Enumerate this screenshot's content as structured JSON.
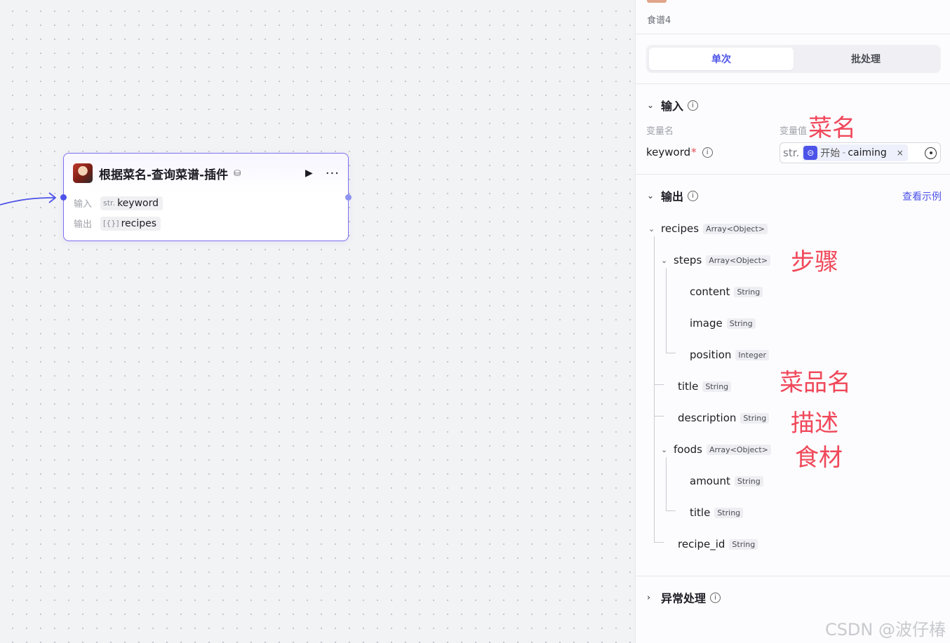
{
  "node": {
    "title": "根据菜名-查询菜谱-插件",
    "title_icon": "⛁",
    "run_icon": "▶",
    "more_icon": "···",
    "input_label": "输入",
    "input_type": "str.",
    "input_param": "keyword",
    "output_label": "输出",
    "output_type": "[{}]",
    "output_param": "recipes"
  },
  "panel": {
    "subtitle": "食谱4",
    "tabs": [
      "单次",
      "批处理"
    ],
    "input_section": "输入",
    "col_name": "变量名",
    "col_value": "变量值",
    "param_name": "keyword",
    "required_mark": "*",
    "value_type": "str.",
    "value_icon": "⊝",
    "value_source": "开始",
    "value_sep": "-",
    "value_var": "caiming",
    "value_clear": "×",
    "output_section": "输出",
    "view_example": "查看示例",
    "exception_section": "异常处理",
    "info_icon": "i"
  },
  "tree": [
    {
      "name": "recipes",
      "type": "Array<Object>"
    },
    {
      "name": "steps",
      "type": "Array<Object>"
    },
    {
      "name": "content",
      "type": "String"
    },
    {
      "name": "image",
      "type": "String"
    },
    {
      "name": "position",
      "type": "Integer"
    },
    {
      "name": "title",
      "type": "String"
    },
    {
      "name": "description",
      "type": "String"
    },
    {
      "name": "foods",
      "type": "Array<Object>"
    },
    {
      "name": "amount",
      "type": "String"
    },
    {
      "name": "title",
      "type": "String"
    },
    {
      "name": "recipe_id",
      "type": "String"
    }
  ],
  "annotations": {
    "caiming": "菜名",
    "steps": "步骤",
    "dish_name": "菜品名",
    "description": "描述",
    "ingredients": "食材"
  },
  "watermark": "CSDN @波仔椿",
  "colors": {
    "accent": "#4d53e8",
    "annotation": "#f0485a",
    "node_border": "#7b6ff0"
  }
}
